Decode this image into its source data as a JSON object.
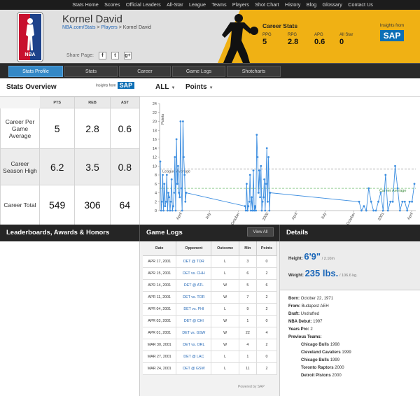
{
  "topnav": [
    "Stats Home",
    "Scores",
    "Official Leaders",
    "All-Star",
    "League",
    "Teams",
    "Players",
    "Shot Chart",
    "History",
    "Blog",
    "Glossary",
    "Contact Us"
  ],
  "logo": {
    "text": "NBA"
  },
  "player": {
    "name": "Kornel David",
    "breadcrumb": {
      "part1": "NBA.com/Stats",
      "sep1": " > ",
      "part2": "Players",
      "sep2": " > ",
      "current": "Kornel David"
    },
    "share_label": "Share Page:",
    "share_icons": {
      "facebook": "f",
      "twitter": "t",
      "googleplus": "g+"
    }
  },
  "career_stats": {
    "title": "Career Stats",
    "items": [
      {
        "label": "PPG",
        "value": "5"
      },
      {
        "label": "RPG",
        "value": "2.8"
      },
      {
        "label": "APG",
        "value": "0.6"
      },
      {
        "label": "All Star",
        "value": "0"
      }
    ],
    "insights": "Insights from",
    "sap": "SAP"
  },
  "tabs": [
    "Stats Profile",
    "Stats",
    "Career",
    "Game Logs",
    "Shotcharts"
  ],
  "overview": {
    "title": "Stats Overview",
    "insights": "Insights from",
    "sap": "SAP",
    "filter1": "ALL",
    "filter2": "Points"
  },
  "stats_table": {
    "headers": [
      "PTS",
      "REB",
      "AST"
    ],
    "rows": [
      {
        "label": "Career Per Game Average",
        "values": [
          "5",
          "2.8",
          "0.6"
        ]
      },
      {
        "label": "Career Season High",
        "values": [
          "6.2",
          "3.5",
          "0.8"
        ]
      },
      {
        "label": "Career Total",
        "values": [
          "549",
          "306",
          "64"
        ]
      }
    ]
  },
  "chart_data": {
    "type": "line",
    "ylabel": "Points",
    "ylim": [
      0,
      24
    ],
    "yticks": [
      0,
      2,
      4,
      6,
      8,
      10,
      12,
      14,
      16,
      18,
      20,
      22,
      24
    ],
    "xticks": [
      "April",
      "July",
      "October",
      "2000",
      "April",
      "July",
      "October",
      "2001",
      "April"
    ],
    "reference_lines": [
      {
        "name": "League Average",
        "value": 9.3,
        "color": "#9a9a9a"
      },
      {
        "name": "Career Average",
        "value": 5,
        "color": "#7ac07a"
      }
    ],
    "series": [
      {
        "color": "#3d8ee0",
        "values": [
          11,
          0,
          2,
          8,
          0,
          6,
          1,
          2,
          8,
          0,
          4,
          3,
          0,
          2,
          7,
          0,
          1,
          4,
          12,
          0,
          16,
          6,
          10,
          4,
          3,
          20,
          5,
          0,
          20,
          12,
          8,
          2,
          4,
          1,
          0,
          6,
          0,
          1,
          2,
          8,
          0,
          3,
          0,
          9,
          0,
          1,
          0,
          17,
          12,
          4,
          9,
          3,
          10,
          0,
          2,
          3,
          7,
          0,
          6,
          14,
          2,
          12,
          0,
          4,
          2,
          0,
          1,
          0,
          5,
          2,
          0,
          0,
          2,
          4,
          0,
          8,
          0,
          2,
          2,
          10,
          5,
          0,
          2,
          2,
          0,
          2,
          2,
          6
        ]
      }
    ]
  },
  "section_heads": {
    "left": "Leaderboards, Awards & Honors",
    "mid": "Game Logs",
    "view_all": "View All",
    "right": "Details"
  },
  "game_logs": {
    "headers": [
      "Date",
      "Opponent",
      "Outcome",
      "Min",
      "Points"
    ],
    "rows": [
      [
        "APR 17, 2001",
        "DET @ TOR",
        "L",
        "3",
        "0"
      ],
      [
        "APR 15, 2001",
        "DET vs. CHH",
        "L",
        "6",
        "2"
      ],
      [
        "APR 14, 2001",
        "DET @ ATL",
        "W",
        "5",
        "6"
      ],
      [
        "APR 11, 2001",
        "DET vs. TOR",
        "W",
        "7",
        "2"
      ],
      [
        "APR 04, 2001",
        "DET vs. PHI",
        "L",
        "9",
        "2"
      ],
      [
        "APR 03, 2001",
        "DET @ CHI",
        "W",
        "1",
        "0"
      ],
      [
        "APR 01, 2001",
        "DET vs. GSW",
        "W",
        "22",
        "4"
      ],
      [
        "MAR 30, 2001",
        "DET vs. ORL",
        "W",
        "4",
        "2"
      ],
      [
        "MAR 27, 2001",
        "DET @ LAC",
        "L",
        "1",
        "0"
      ],
      [
        "MAR 24, 2001",
        "DET @ GSW",
        "L",
        "11",
        "2"
      ]
    ],
    "powered": "Powered by SAP"
  },
  "details": {
    "height_label": "Height:",
    "height": "6'9\"",
    "height_metric": "/ 2.10m",
    "weight_label": "Weight:",
    "weight": "235 lbs.",
    "weight_metric": "/ 106.6 kg.",
    "born_label": "Born:",
    "born": "October 22, 1971",
    "from_label": "From:",
    "from": "Budapest AEH",
    "draft_label": "Draft:",
    "draft": "Undrafted",
    "debut_label": "NBA Debut:",
    "debut": "1997",
    "pro_label": "Years Pro:",
    "pro": "2",
    "prev_label": "Previous Teams:",
    "teams": [
      {
        "team": "Chicago Bulls",
        "year": "1998"
      },
      {
        "team": "Cleveland Cavaliers",
        "year": "1999"
      },
      {
        "team": "Chicago Bulls",
        "year": "1999"
      },
      {
        "team": "Toronto Raptors",
        "year": "2000"
      },
      {
        "team": "Detroit Pistons",
        "year": "2000"
      }
    ]
  }
}
